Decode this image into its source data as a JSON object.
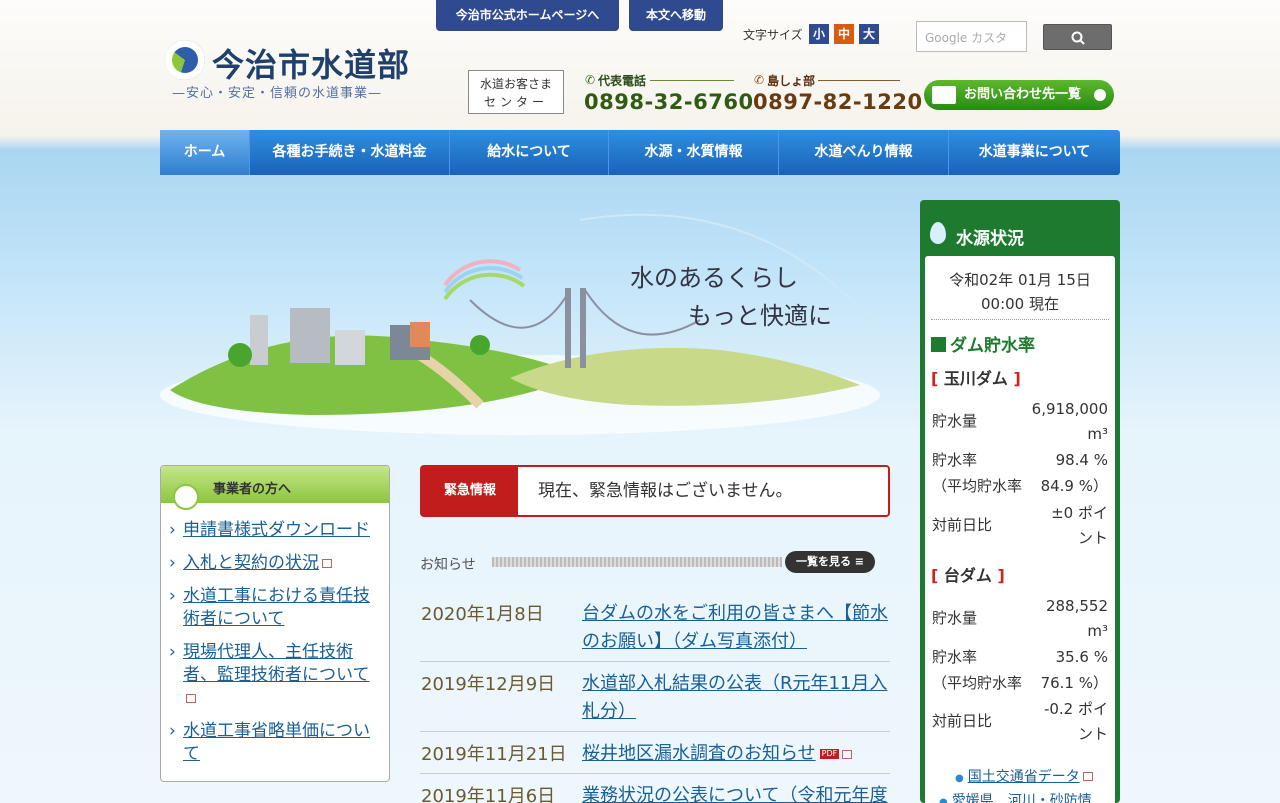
{
  "header": {
    "top_links": [
      "今治市公式ホームページへ",
      "本文へ移動"
    ],
    "logo_title": "今治市水道部",
    "logo_subtitle": "—安心・安定・信頼の水道事業—",
    "font_size_label": "文字サイズ",
    "font_sizes": [
      "小",
      "中",
      "大"
    ],
    "search_placeholder": "Google カスタ",
    "center": [
      "水道お客さま",
      "センター"
    ],
    "phones": [
      {
        "label": "代表電話",
        "number": "0898-32-6760"
      },
      {
        "label": "島しょ部",
        "number": "0897-82-1220"
      }
    ],
    "contact_label": "お問い合わせ先一覧"
  },
  "nav": [
    "ホーム",
    "各種お手続き・水道料金",
    "給水について",
    "水源・水質情報",
    "水道べんり情報",
    "水道事業について"
  ],
  "hero": {
    "line1": "水のあるくらし",
    "line2": "もっと快適に"
  },
  "business": {
    "heading": "事業者の方へ",
    "links": [
      "申請書様式ダウンロード",
      "入札と契約の状況",
      "水道工事における責任技術者について",
      "現場代理人、主任技術者、監理技術者について",
      "水道工事省略単価について"
    ]
  },
  "emergency": {
    "tag": "緊急情報",
    "text": "現在、緊急情報はございません。"
  },
  "news": {
    "heading": "お知らせ",
    "more": "一覧を見る",
    "items": [
      {
        "date": "2020年1月8日",
        "title": "台ダムの水をご利用の皆さまへ【節水のお願い】（ダム写真添付）"
      },
      {
        "date": "2019年12月9日",
        "title": "水道部入札結果の公表（R元年11月入札分）"
      },
      {
        "date": "2019年11月21日",
        "title": "桜井地区漏水調査のお知らせ",
        "pdf": "PDF"
      },
      {
        "date": "2019年11月6日",
        "title": "業務状況の公表について（令和元年度"
      }
    ]
  },
  "water": {
    "title": "水源状況",
    "date": "令和02年 01月 15日",
    "time": "00:00 現在",
    "rate_heading": "ダム貯水率",
    "dams": [
      {
        "name": "玉川ダム",
        "volume_label": "貯水量",
        "volume": "6,918,000",
        "unit": "m³",
        "rate_label": "貯水率",
        "rate": "98.4 %",
        "avg_label": "（平均貯水率",
        "avg": "84.9 %）",
        "diff_label": "対前日比",
        "diff": "±0 ポイ",
        "diff2": "ント"
      },
      {
        "name": "台ダム",
        "volume_label": "貯水量",
        "volume": "288,552",
        "unit": "m³",
        "rate_label": "貯水率",
        "rate": "35.6 %",
        "avg_label": "（平均貯水率",
        "avg": "76.1 %）",
        "diff_label": "対前日比",
        "diff": "-0.2 ポイ",
        "diff2": "ント"
      }
    ],
    "links": [
      "国土交通省データ",
      "愛媛県　河川・砂防情"
    ]
  }
}
